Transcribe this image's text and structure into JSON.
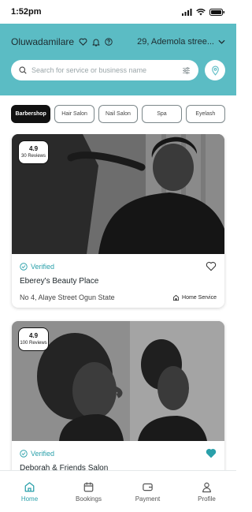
{
  "status_bar": {
    "time": "1:52pm"
  },
  "header": {
    "user_name": "Oluwadamilare",
    "location": "29, Ademola stree..."
  },
  "search": {
    "placeholder": "Search for service or business name"
  },
  "categories": [
    {
      "label": "Barbershop",
      "active": true
    },
    {
      "label": "Hair Salon",
      "active": false
    },
    {
      "label": "Nail Salon",
      "active": false
    },
    {
      "label": "Spa",
      "active": false
    },
    {
      "label": "Eyelash",
      "active": false
    }
  ],
  "businesses": [
    {
      "rating": "4.9",
      "reviews": "30 Reviews",
      "verified_label": "Verified",
      "name": "Eberey's Beauty Place",
      "address": "No 4, Alaye Street Ogun State",
      "service_label": "Home Service",
      "favorited": false
    },
    {
      "rating": "4.9",
      "reviews": "100 Reviews",
      "verified_label": "Verified",
      "name": "Deborah & Friends Salon",
      "favorited": true
    }
  ],
  "bottom_nav": [
    {
      "label": "Home",
      "icon": "home-icon",
      "active": true
    },
    {
      "label": "Bookings",
      "icon": "calendar-icon",
      "active": false
    },
    {
      "label": "Payment",
      "icon": "wallet-icon",
      "active": false
    },
    {
      "label": "Profile",
      "icon": "user-icon",
      "active": false
    }
  ],
  "colors": {
    "accent": "#5bbcc4",
    "accent_dark": "#2aa0aa",
    "chip_active": "#111111"
  }
}
